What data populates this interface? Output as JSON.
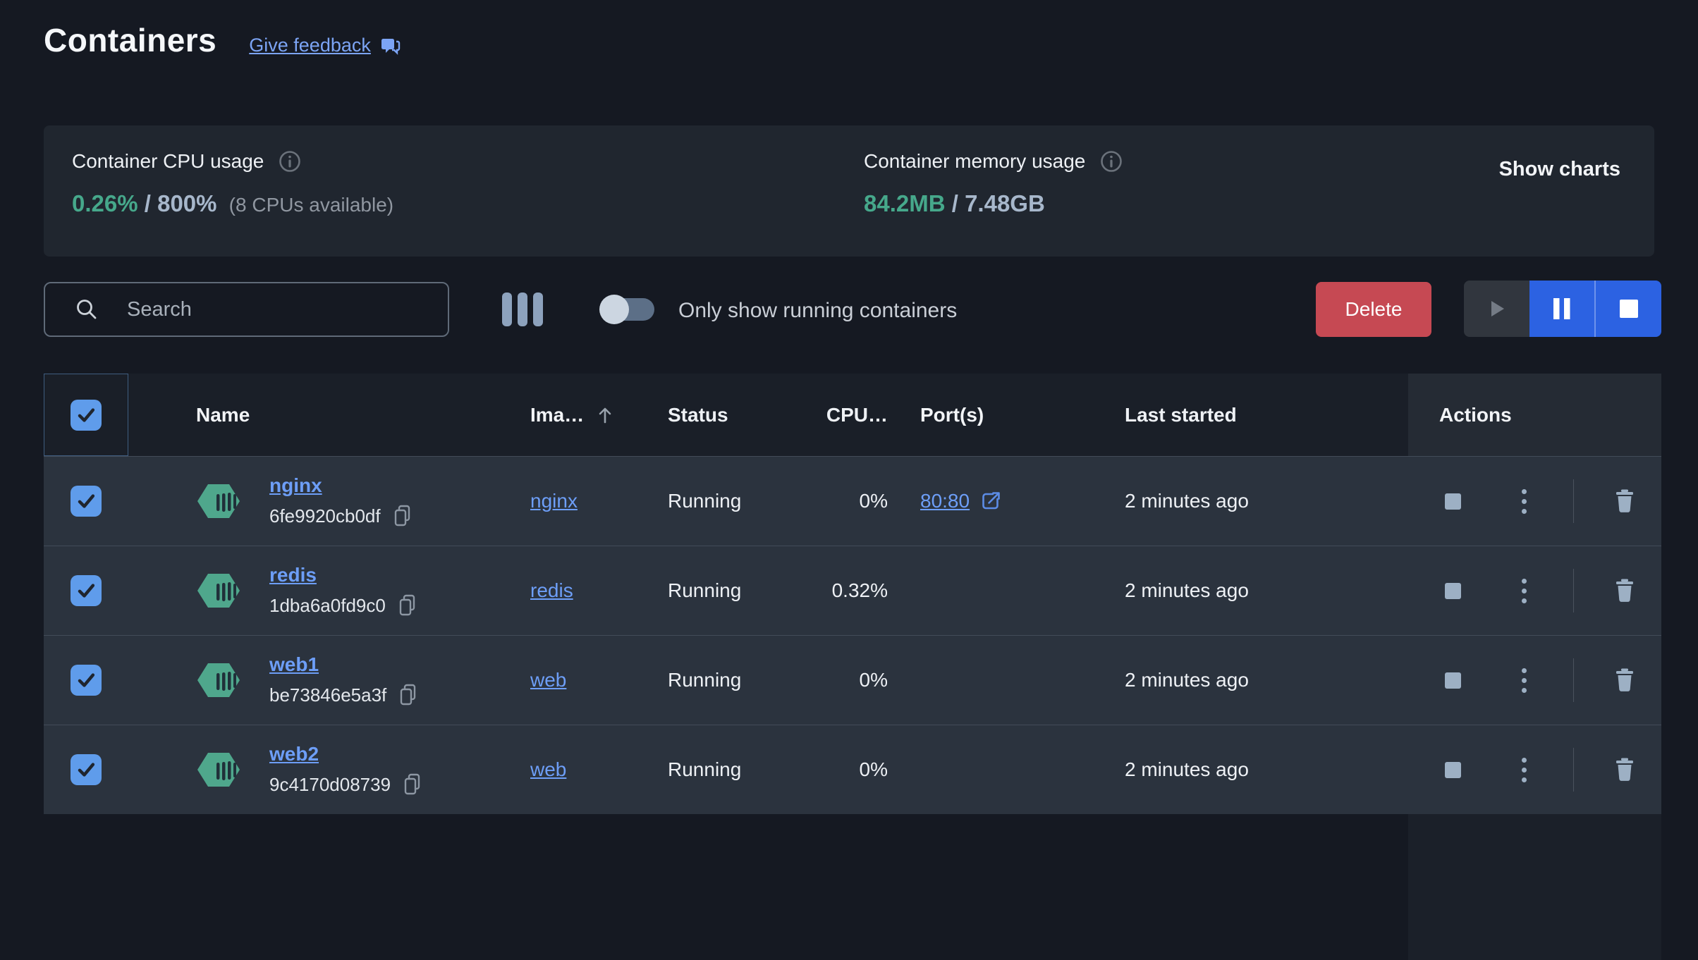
{
  "header": {
    "title": "Containers",
    "feedback_link": "Give feedback"
  },
  "stats": {
    "cpu": {
      "label": "Container CPU usage",
      "used": "0.26%",
      "sep": " / ",
      "total": "800%",
      "note": "(8 CPUs available)"
    },
    "memory": {
      "label": "Container memory usage",
      "used": "84.2MB",
      "sep": " / ",
      "total": "7.48GB"
    },
    "show_charts_label": "Show charts"
  },
  "toolbar": {
    "search_placeholder": "Search",
    "toggle_label": "Only show running containers",
    "toggle_state": "off",
    "delete_label": "Delete"
  },
  "table": {
    "select_all_checked": true,
    "headers": {
      "name": "Name",
      "image": "Ima…",
      "status": "Status",
      "cpu": "CPU…",
      "ports": "Port(s)",
      "last_started": "Last started",
      "actions": "Actions"
    },
    "rows": [
      {
        "name": "nginx",
        "hash": "6fe9920cb0df",
        "image": "nginx",
        "status": "Running",
        "cpu": "0%",
        "ports": "80:80",
        "last_started": "2 minutes ago",
        "checked": true
      },
      {
        "name": "redis",
        "hash": "1dba6a0fd9c0",
        "image": "redis",
        "status": "Running",
        "cpu": "0.32%",
        "ports": "",
        "last_started": "2 minutes ago",
        "checked": true
      },
      {
        "name": "web1",
        "hash": "be73846e5a3f",
        "image": "web",
        "status": "Running",
        "cpu": "0%",
        "ports": "",
        "last_started": "2 minutes ago",
        "checked": true
      },
      {
        "name": "web2",
        "hash": "9c4170d08739",
        "image": "web",
        "status": "Running",
        "cpu": "0%",
        "ports": "",
        "last_started": "2 minutes ago",
        "checked": true
      }
    ]
  },
  "icons": {
    "feedback": "chat-bubble",
    "info": "circle-i",
    "search": "magnifier",
    "columns": "three-vertical-bars",
    "sort": "arrow-up",
    "container": "green-hexagon-slats",
    "copy": "two-rectangles",
    "external_link": "box-arrow",
    "row_stop": "square",
    "row_menu": "kebab-dots",
    "row_delete": "trash-can",
    "bulk_play": "triangle",
    "bulk_pause": "two-bars",
    "bulk_stop": "square"
  },
  "colors": {
    "page_bg": "#151922",
    "card_bg": "#20262f",
    "row_bg": "#2b333e",
    "accent_green": "#46a88b",
    "slate_value": "#a7b7cb",
    "link_blue": "#6d9ef7",
    "delete_red": "#c64953",
    "action_blue": "#2c62e2",
    "checkbox_blue": "#5f9ceb",
    "icon_gray": "#9db0c4"
  }
}
